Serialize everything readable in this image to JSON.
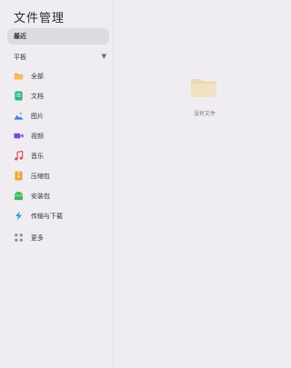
{
  "app": {
    "title": "文件管理"
  },
  "sidebar": {
    "recent_label": "最近",
    "section_label": "平板",
    "items": [
      {
        "label": "全部",
        "icon": "folder-icon",
        "color": "#f2a33a"
      },
      {
        "label": "文档",
        "icon": "document-icon",
        "color": "#2cb87a"
      },
      {
        "label": "图片",
        "icon": "image-icon",
        "color": "#3f7fe0"
      },
      {
        "label": "视频",
        "icon": "video-icon",
        "color": "#7c4ae0"
      },
      {
        "label": "音乐",
        "icon": "music-icon",
        "color": "#e04a5f"
      },
      {
        "label": "压缩包",
        "icon": "archive-icon",
        "color": "#f2a33a"
      },
      {
        "label": "安装包",
        "icon": "android-package-icon",
        "color": "#3fb95a"
      },
      {
        "label": "传输与下载",
        "icon": "transfer-icon",
        "color": "#2a9fd8"
      },
      {
        "label": "更多",
        "icon": "more-grid-icon",
        "color": "#8a8f9a"
      }
    ]
  },
  "main": {
    "empty_text": "没有文件"
  }
}
